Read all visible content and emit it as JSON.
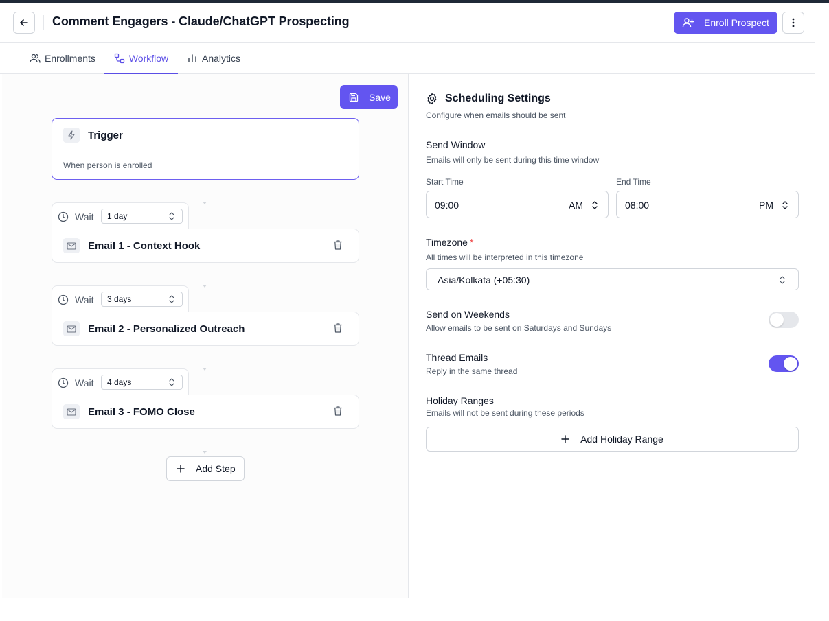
{
  "header": {
    "title": "Comment Engagers - Claude/ChatGPT Prospecting",
    "enroll_label": "Enroll Prospect"
  },
  "tabs": [
    {
      "label": "Enrollments",
      "icon": "users-icon",
      "active": false
    },
    {
      "label": "Workflow",
      "icon": "workflow-icon",
      "active": true
    },
    {
      "label": "Analytics",
      "icon": "bar-chart-icon",
      "active": false
    }
  ],
  "workflow": {
    "save_label": "Save",
    "trigger": {
      "title": "Trigger",
      "description": "When person is enrolled"
    },
    "steps": [
      {
        "wait_label": "Wait",
        "wait_value": "1 day",
        "email_title": "Email 1 - Context Hook"
      },
      {
        "wait_label": "Wait",
        "wait_value": "3 days",
        "email_title": "Email 2 - Personalized Outreach"
      },
      {
        "wait_label": "Wait",
        "wait_value": "4 days",
        "email_title": "Email 3 - FOMO Close"
      }
    ],
    "add_step_label": "Add Step"
  },
  "scheduling": {
    "title": "Scheduling Settings",
    "description": "Configure when emails should be sent",
    "send_window": {
      "title": "Send Window",
      "description": "Emails will only be sent during this time window",
      "start_label": "Start Time",
      "start_value": "09:00",
      "start_period": "AM",
      "end_label": "End Time",
      "end_value": "08:00",
      "end_period": "PM"
    },
    "timezone": {
      "title": "Timezone",
      "required_mark": "*",
      "description": "All times will be interpreted in this timezone",
      "value": "Asia/Kolkata (+05:30)"
    },
    "weekends": {
      "title": "Send on Weekends",
      "description": "Allow emails to be sent on Saturdays and Sundays",
      "enabled": false
    },
    "thread": {
      "title": "Thread Emails",
      "description": "Reply in the same thread",
      "enabled": true
    },
    "holidays": {
      "title": "Holiday Ranges",
      "description": "Emails will not be sent during these periods",
      "add_label": "Add Holiday Range"
    }
  },
  "colors": {
    "accent": "#6355f0",
    "active_tab": "#5b4ee6",
    "required": "#ef4444"
  }
}
